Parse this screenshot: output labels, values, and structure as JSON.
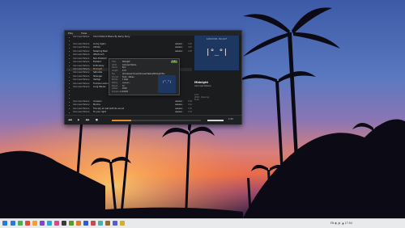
{
  "menu": {
    "file": "Play",
    "view": "View",
    "tag": "Ctrl+Enter"
  },
  "playlist": [
    {
      "num": "",
      "artist": "Carousel Palace",
      "title": "Chord Patrick Bhere By Rainy Parry",
      "stars": "",
      "dur": ""
    },
    {
      "num": "",
      "artist": "",
      "title": "",
      "stars": "",
      "dur": ""
    },
    {
      "num": "",
      "artist": "Carousel Palace",
      "title": "Lucky Again",
      "stars": "★★★★☆",
      "dur": "3:41"
    },
    {
      "num": "",
      "artist": "Carousel Palace",
      "title": "Infinity",
      "stars": "★★★★☆",
      "dur": "4:04"
    },
    {
      "num": "",
      "artist": "Carousel Palace",
      "title": "Sleeping Bear",
      "stars": "★★★★☆",
      "dur": "4:25"
    },
    {
      "num": "",
      "artist": "Carousel Palace",
      "title": "Aftertouch",
      "stars": "",
      "dur": ""
    },
    {
      "num": "",
      "artist": "Carousel Palace",
      "title": "Non-Existent",
      "stars": "",
      "dur": ""
    },
    {
      "num": "",
      "artist": "Carousel Palace",
      "title": "Esoteric",
      "stars": "",
      "dur": ""
    },
    {
      "num": "",
      "artist": "Carousel Palace",
      "title": "Drift Away",
      "stars": "",
      "dur": ""
    },
    {
      "num": "",
      "artist": "Carousel Palace",
      "title": "Midnight",
      "stars": "",
      "dur": ""
    },
    {
      "num": "",
      "artist": "Carousel Palace",
      "title": "Saturate",
      "stars": "",
      "dur": ""
    },
    {
      "num": "",
      "artist": "Carousel Palace",
      "title": "Stranger",
      "stars": "",
      "dur": ""
    },
    {
      "num": "",
      "artist": "Carousel Palace",
      "title": "Vertigo",
      "stars": "",
      "dur": ""
    },
    {
      "num": "",
      "artist": "Carousel Palace",
      "title": "Fuchsia Lantern 99",
      "stars": "",
      "dur": ""
    },
    {
      "num": "",
      "artist": "Carousel Palace",
      "title": "Long Waves",
      "stars": "",
      "dur": ""
    },
    {
      "num": "",
      "artist": "",
      "title": "",
      "stars": "",
      "dur": ""
    },
    {
      "num": "",
      "artist": "",
      "title": "",
      "stars": "",
      "dur": ""
    },
    {
      "num": "",
      "artist": "",
      "title": "",
      "stars": "",
      "dur": ""
    },
    {
      "num": "",
      "artist": "Carousel Palace",
      "title": "Invasion",
      "stars": "★★★★☆",
      "dur": "3:56"
    },
    {
      "num": "",
      "artist": "Carousel Palace",
      "title": "Marina",
      "stars": "★★★★☆",
      "dur": "4:12"
    },
    {
      "num": "",
      "artist": "Carousel Palace",
      "title": "The sky at rest with its sound",
      "stars": "★★★★☆",
      "dur": "3:33"
    },
    {
      "num": "",
      "artist": "Carousel Palace",
      "title": "To your light",
      "stars": "★★★★☆",
      "dur": "4:18"
    },
    {
      "num": "",
      "artist": "Carousel Palace",
      "title": "Distinctive",
      "stars": "★★★★☆",
      "dur": "4:07"
    }
  ],
  "active_index": 9,
  "cover": {
    "label": "CAROUSEL PALACE",
    "face": "|°_°|"
  },
  "now_playing": {
    "title": "Midnight",
    "artist": "Carousel Palace",
    "meta1": "4:07",
    "meta2": "2018 · Dancing",
    "meta3": "FLAC"
  },
  "popup": {
    "rows": [
      {
        "k": "Title",
        "v": "Midnight"
      },
      {
        "k": "Artist",
        "v": "Carousel Palace"
      },
      {
        "k": "Album",
        "v": "Epic"
      },
      {
        "k": "Length",
        "v": "4:07"
      },
      {
        "k": "File",
        "v": "/home/user/music/Carousel Palace/Midnight.flac"
      },
      {
        "k": "Format",
        "v": "FLAC · Stereo"
      },
      {
        "k": "Bitrate",
        "v": "1 kbps"
      },
      {
        "k": "Rating",
        "v": "★★★★☆"
      },
      {
        "k": "Played",
        "v": "12"
      },
      {
        "k": "Added",
        "v": "2018"
      },
      {
        "k": "Sample rate",
        "v": "44100"
      }
    ],
    "badge": "FLAC",
    "thumb": "|°_°|"
  },
  "transport": {
    "prev": "◀◀",
    "play": "▶",
    "next": "▶▶",
    "stop": "■",
    "time": "1:23",
    "progress": 0.22
  },
  "taskbar": {
    "icons": [
      "#2a7ad4",
      "#4caf50",
      "#e04b3a",
      "#f0a030",
      "#7a4ac9",
      "#2aa8d4",
      "#d44a8a",
      "#3a3a3a",
      "#5a9a2a",
      "#e07a2a",
      "#2a5ad4",
      "#c94a4a",
      "#4ab0b0",
      "#9a6a2a",
      "#5a5ad4",
      "#d4b02a"
    ],
    "tray": "EN  ◐  🔊  ▲  17:54"
  }
}
